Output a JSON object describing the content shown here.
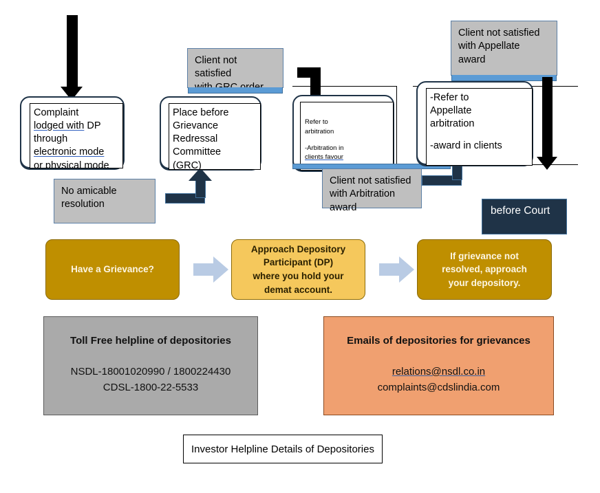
{
  "diagram": {
    "title": "Investor Helpline Details of Depositories",
    "colors": {
      "box_outline": "#1f3347",
      "callout_fill": "#bfbfbf",
      "callout_border": "#5b7fa6",
      "blue_accent": "#5b9bd5",
      "dark_navy": "#1f3347",
      "gold_dark": "#bf8f00",
      "gold_light": "#f5c85c",
      "chevron_blue": "#b9cbe4",
      "panel_grey": "#aaaaaa",
      "panel_peach": "#f0a070",
      "link_blue": "#3b5fa0",
      "spellcheck_red": "#d32f2f"
    },
    "process_boxes": [
      {
        "id": "complaint",
        "lines": [
          {
            "text": "Complaint",
            "underline": false
          },
          {
            "text": "lodged with",
            "underline": true,
            "suffix": " DP"
          },
          {
            "text": "through",
            "underline": false
          },
          {
            "text": "electronic  mode",
            "underline": true
          },
          {
            "text": "or physical mode",
            "underline": false
          }
        ]
      },
      {
        "id": "grc",
        "lines": [
          {
            "text": "Place before",
            "underline": false
          },
          {
            "text": "Grievance",
            "underline": false
          },
          {
            "text": "Redressal",
            "underline": false
          },
          {
            "text": "Committee",
            "underline": false
          },
          {
            "text": "(GRC)",
            "underline": false
          }
        ]
      },
      {
        "id": "arbitration",
        "small": true,
        "lines": [
          {
            "text": "Refer to",
            "underline": false
          },
          {
            "text": "arbitration",
            "underline": false
          },
          {
            "text": "",
            "underline": false
          },
          {
            "text": "-Arbitration in",
            "underline": false
          },
          {
            "text": "clients favour",
            "underline": true,
            "spellcheck": true
          }
        ]
      },
      {
        "id": "appellate",
        "lines": [
          {
            "text": "-Refer    to",
            "underline": false
          },
          {
            "text": "Appellate",
            "underline": false
          },
          {
            "text": "arbitration",
            "underline": false
          },
          {
            "text": "",
            "underline": false
          },
          {
            "text": "-award in clients",
            "underline": false
          }
        ]
      }
    ],
    "callouts": [
      {
        "id": "no-amicable",
        "lines": [
          "No amicable",
          "resolution"
        ],
        "blue_foot": false
      },
      {
        "id": "grc-order",
        "lines": [
          "Client not satisfied",
          "with GRC order"
        ],
        "blue_foot": true
      },
      {
        "id": "arb-award",
        "lines": [
          "Client not satisfied",
          "with Arbitration",
          "award"
        ],
        "blue_foot": false
      },
      {
        "id": "appellate-award",
        "lines": [
          "Client not satisfied",
          "with Appellate",
          "award"
        ],
        "blue_foot": true
      }
    ],
    "court_box": {
      "label": "before Court"
    },
    "steps": [
      {
        "id": "step-1",
        "style": "dark",
        "lines": [
          "Have a Grievance?"
        ]
      },
      {
        "id": "step-2",
        "style": "light",
        "lines": [
          "Approach Depository",
          "Participant (DP)",
          "where you hold your",
          "demat account."
        ]
      },
      {
        "id": "step-3",
        "style": "dark",
        "lines": [
          "If grievance not",
          "resolved, approach",
          "your depository."
        ]
      }
    ],
    "panels": {
      "helpline": {
        "heading": "Toll Free helpline of depositories",
        "line1": "NSDL-18001020990 / 1800224430",
        "line2": "CDSL-1800-22-5533"
      },
      "emails": {
        "heading": "Emails of depositories  for grievances",
        "line1": "relations@nsdl.co.in",
        "line2": "complaints@cdslindia.com"
      }
    },
    "arrows": [
      {
        "id": "entry-arrow-down",
        "kind": "down",
        "color": "#000000"
      },
      {
        "id": "grc-to-arbitration-elbow",
        "kind": "right-down",
        "color": "#000000"
      },
      {
        "id": "no-amicable-to-grc-elbow",
        "kind": "right-up",
        "color": "#1f3347"
      },
      {
        "id": "arb-award-to-appellate-elbow",
        "kind": "right-up",
        "color": "#1f3347"
      },
      {
        "id": "appellate-to-court-arrow",
        "kind": "down",
        "color": "#000000"
      },
      {
        "id": "step-1-to-step-2-chevron",
        "kind": "chevron-right",
        "color": "#b9cbe4"
      },
      {
        "id": "step-2-to-step-3-chevron",
        "kind": "chevron-right",
        "color": "#b9cbe4"
      }
    ]
  }
}
